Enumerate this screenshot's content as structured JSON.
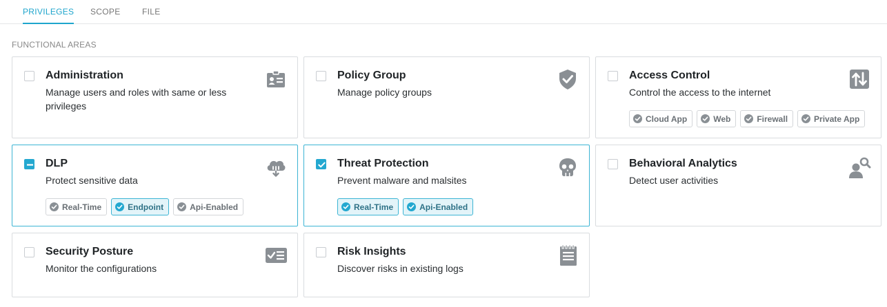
{
  "tabs": [
    {
      "label": "PRIVILEGES",
      "active": true
    },
    {
      "label": "SCOPE",
      "active": false
    },
    {
      "label": "FILE",
      "active": false
    }
  ],
  "section_title": "FUNCTIONAL AREAS",
  "colors": {
    "accent": "#24a8d0",
    "border": "#d9dcdf",
    "icon": "#8a8f94"
  },
  "cards": [
    {
      "title": "Administration",
      "description": "Manage users and roles with same or less privileges",
      "icon": "id-badge-icon",
      "state": "unchecked",
      "pills": []
    },
    {
      "title": "Policy Group",
      "description": "Manage policy groups",
      "icon": "shield-check-icon",
      "state": "unchecked",
      "pills": []
    },
    {
      "title": "Access Control",
      "description": "Control the access to the internet",
      "icon": "transfer-arrows-icon",
      "state": "unchecked",
      "pills": [
        {
          "label": "Cloud App",
          "on": false
        },
        {
          "label": "Web",
          "on": false
        },
        {
          "label": "Firewall",
          "on": false
        },
        {
          "label": "Private App",
          "on": false
        }
      ]
    },
    {
      "title": "DLP",
      "description": "Protect sensitive data",
      "icon": "cloud-download-icon",
      "state": "partial",
      "pills": [
        {
          "label": "Real-Time",
          "on": false
        },
        {
          "label": "Endpoint",
          "on": true
        },
        {
          "label": "Api-Enabled",
          "on": false
        }
      ]
    },
    {
      "title": "Threat Protection",
      "description": "Prevent malware and malsites",
      "icon": "skull-icon",
      "state": "checked",
      "pills": [
        {
          "label": "Real-Time",
          "on": true
        },
        {
          "label": "Api-Enabled",
          "on": true
        }
      ]
    },
    {
      "title": "Behavioral Analytics",
      "description": "Detect user activities",
      "icon": "user-search-icon",
      "state": "unchecked",
      "pills": []
    },
    {
      "title": "Security Posture",
      "description": "Monitor the configurations",
      "icon": "checklist-icon",
      "state": "unchecked",
      "pills": []
    },
    {
      "title": "Risk Insights",
      "description": "Discover risks in existing logs",
      "icon": "log-notepad-icon",
      "state": "unchecked",
      "pills": []
    }
  ]
}
